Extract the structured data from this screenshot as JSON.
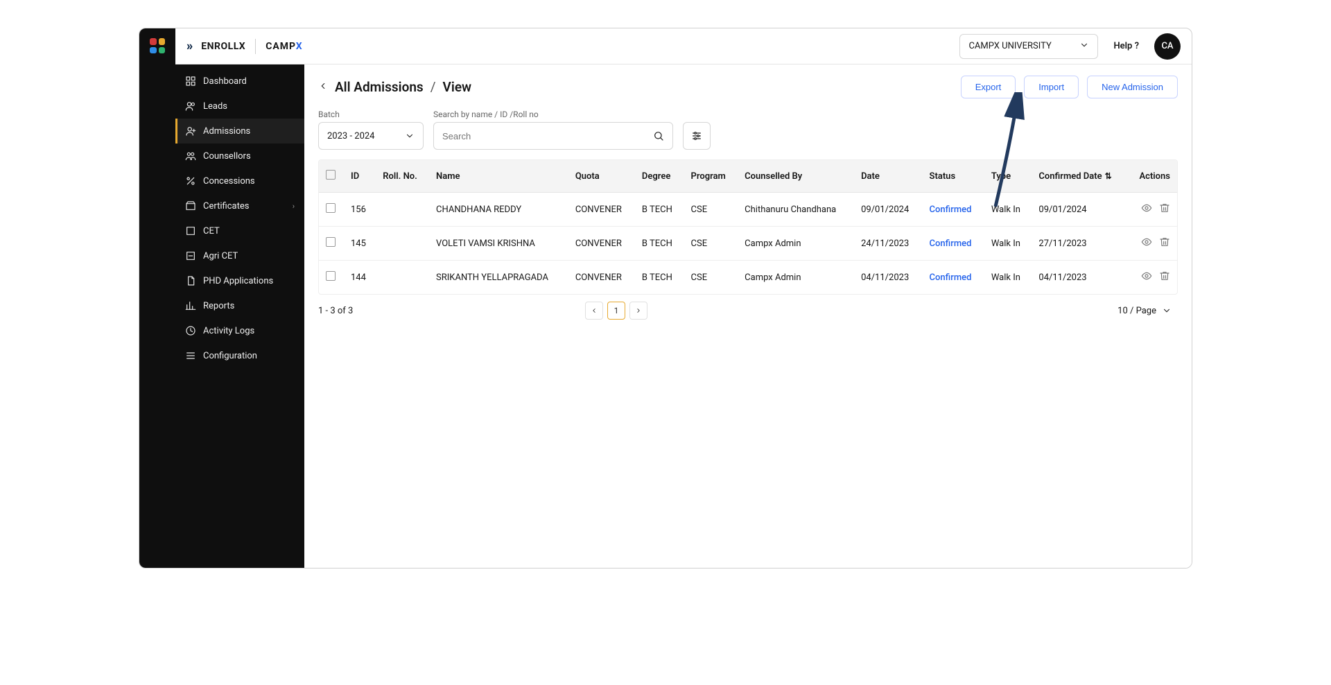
{
  "header": {
    "brand1": "ENROLLX",
    "brand2a": "CAMP",
    "brand2b": "X",
    "university": "CAMPX UNIVERSITY",
    "help": "Help ?",
    "avatar": "CA"
  },
  "sidebar": {
    "items": [
      {
        "label": "Dashboard",
        "icon": "grid"
      },
      {
        "label": "Leads",
        "icon": "users"
      },
      {
        "label": "Admissions",
        "icon": "user-plus",
        "active": true
      },
      {
        "label": "Counsellors",
        "icon": "people"
      },
      {
        "label": "Concessions",
        "icon": "percent"
      },
      {
        "label": "Certificates",
        "icon": "box",
        "chevron": true
      },
      {
        "label": "CET",
        "icon": "square"
      },
      {
        "label": "Agri CET",
        "icon": "leaf"
      },
      {
        "label": "PHD Applications",
        "icon": "doc"
      },
      {
        "label": "Reports",
        "icon": "bar"
      },
      {
        "label": "Activity Logs",
        "icon": "clock"
      },
      {
        "label": "Configuration",
        "icon": "sliders"
      }
    ]
  },
  "page": {
    "breadcrumb": {
      "root": "All Admissions",
      "sep": "/",
      "leaf": "View"
    },
    "actions": {
      "export": "Export",
      "import": "Import",
      "new": "New Admission"
    },
    "filters": {
      "batch_label": "Batch",
      "batch_value": "2023 - 2024",
      "search_label": "Search by name / ID /Roll no",
      "search_placeholder": "Search"
    },
    "table": {
      "columns": [
        "",
        "ID",
        "Roll. No.",
        "Name",
        "Quota",
        "Degree",
        "Program",
        "Counselled By",
        "Date",
        "Status",
        "Type",
        "Confirmed Date",
        "Actions"
      ],
      "sort_col": "Confirmed Date",
      "rows": [
        {
          "id": "156",
          "roll": "",
          "name": "CHANDHANA REDDY",
          "quota": "CONVENER",
          "degree": "B TECH",
          "program": "CSE",
          "by": "Chithanuru Chandhana",
          "date": "09/01/2024",
          "status": "Confirmed",
          "type": "Walk In",
          "confirmed": "09/01/2024"
        },
        {
          "id": "145",
          "roll": "",
          "name": "VOLETI VAMSI KRISHNA",
          "quota": "CONVENER",
          "degree": "B TECH",
          "program": "CSE",
          "by": "Campx Admin",
          "date": "24/11/2023",
          "status": "Confirmed",
          "type": "Walk In",
          "confirmed": "27/11/2023"
        },
        {
          "id": "144",
          "roll": "",
          "name": "SRIKANTH YELLAPRAGADA",
          "quota": "CONVENER",
          "degree": "B TECH",
          "program": "CSE",
          "by": "Campx Admin",
          "date": "04/11/2023",
          "status": "Confirmed",
          "type": "Walk In",
          "confirmed": "04/11/2023"
        }
      ]
    },
    "footer": {
      "range": "1 - 3 of 3",
      "page": "1",
      "per_page": "10 / Page"
    }
  }
}
